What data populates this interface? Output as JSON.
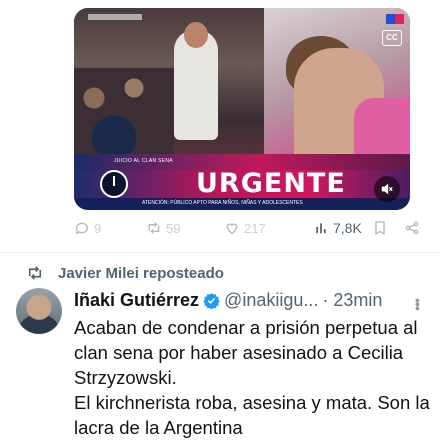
{
  "media": {
    "headline": "URGENTE",
    "banner_top": "JUICIO AL CLAN SENA",
    "banner_bottom": "ATENCIÓN: PÚBLICO APTO PARA NIÑOS, NIÑAS Y ADOLESCENTES",
    "cc_label": "CC"
  },
  "actions": {
    "reply_count": "9",
    "retweet_count": "59",
    "like_count": "217",
    "views_count": "7,8K"
  },
  "retweeted_by": "Javier Milei reposteado",
  "tweet": {
    "name": "Iñaki Gutiérrez",
    "handle": "@inakiigu...",
    "time": "· 23min",
    "text": "Acaban de condenar a prisión perpetua al clan sena por haber asesinado a Cecilia Strzyzowski.\nEl kirchnerista roba, asesina y mata. Son la lacra de la Argentina"
  },
  "colors": {
    "verified": "#1d9bf0",
    "secondary_text": "#536471",
    "urgente_banner": "#c2185b"
  }
}
